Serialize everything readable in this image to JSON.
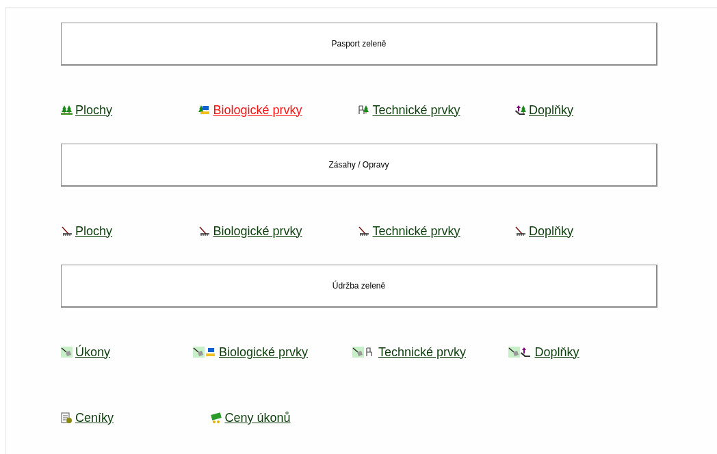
{
  "sections": [
    {
      "title": "Pasport zeleně",
      "rows": [
        [
          {
            "label": "Plochy",
            "kind": "area",
            "active": false
          },
          {
            "label": "Biologické prvky",
            "kind": "bio",
            "active": true
          },
          {
            "label": "Technické prvky",
            "kind": "tech",
            "active": false
          },
          {
            "label": "Doplňky",
            "kind": "extra",
            "active": false
          }
        ]
      ]
    },
    {
      "title": "Zásahy / Opravy",
      "rows": [
        [
          {
            "label": "Plochy",
            "kind": "rake",
            "active": false
          },
          {
            "label": "Biologické prvky",
            "kind": "rake",
            "active": false
          },
          {
            "label": "Technické prvky",
            "kind": "rake",
            "active": false
          },
          {
            "label": "Doplňky",
            "kind": "rake",
            "active": false
          }
        ]
      ]
    },
    {
      "title": "Údržba zeleně",
      "rows": [
        [
          {
            "label": "Úkony",
            "kind": "shovel",
            "active": false
          },
          {
            "label": "Biologické prvky",
            "kind": "shovelbio",
            "active": false
          },
          {
            "label": "Technické prvky",
            "kind": "shoveltech",
            "active": false
          },
          {
            "label": "Doplňky",
            "kind": "shovelextra",
            "active": false
          }
        ],
        [
          {
            "label": "Ceníky",
            "kind": "pricelist",
            "active": false
          },
          {
            "label": "Ceny úkonů",
            "kind": "prices",
            "active": false
          }
        ]
      ]
    }
  ]
}
